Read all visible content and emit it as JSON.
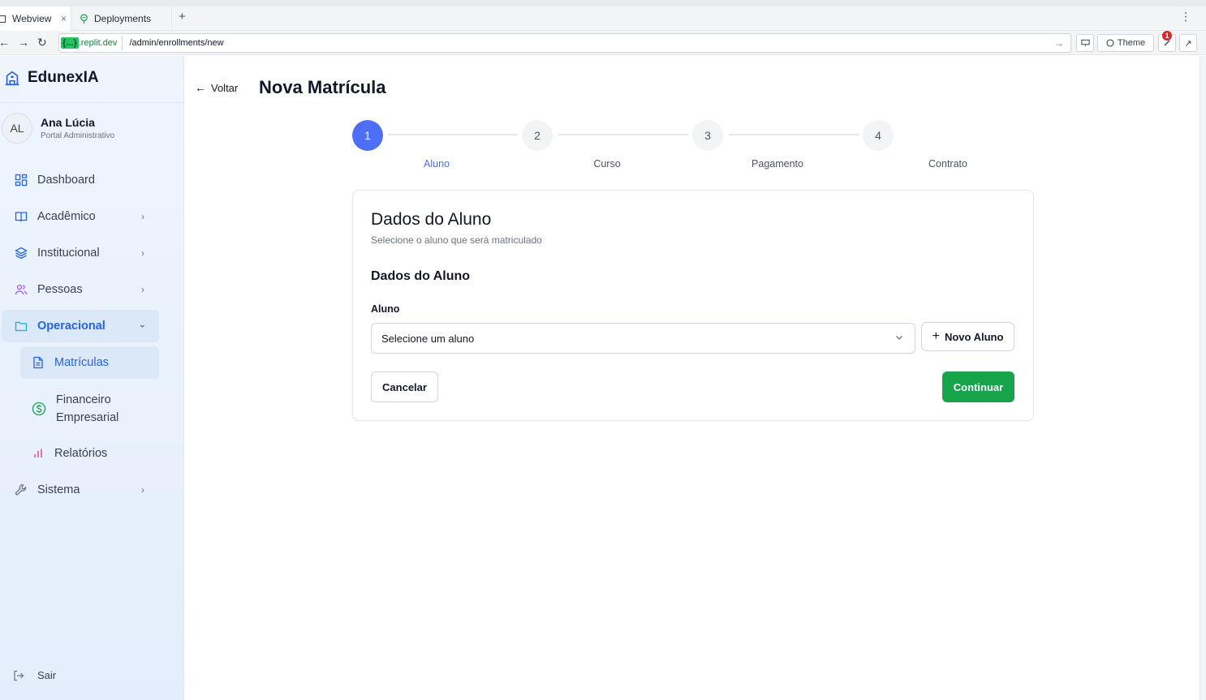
{
  "browser": {
    "tabs": [
      {
        "label": "Webview",
        "close": "×"
      },
      {
        "label": "Deployments"
      }
    ],
    "new_tab": "+",
    "url_host_badge": "{...}",
    "url_host": ".replit.dev",
    "url_path": "/admin/enrollments/new",
    "theme_label": "Theme",
    "notification_count": "1"
  },
  "sidebar": {
    "brand": "EdunexIA",
    "user": {
      "initials": "AL",
      "name": "Ana Lúcia",
      "role": "Portal Administrativo"
    },
    "items": [
      {
        "label": "Dashboard",
        "icon": "dashboard-icon"
      },
      {
        "label": "Acadêmico",
        "icon": "book-icon"
      },
      {
        "label": "Institucional",
        "icon": "layers-icon"
      },
      {
        "label": "Pessoas",
        "icon": "users-icon"
      },
      {
        "label": "Operacional",
        "icon": "folder-icon"
      },
      {
        "label": "Sistema",
        "icon": "wrench-icon"
      }
    ],
    "subitems": [
      {
        "label": "Matrículas",
        "icon": "file-icon"
      },
      {
        "label": "Financeiro",
        "label2": "Empresarial",
        "icon": "dollar-icon"
      },
      {
        "label": "Relatórios",
        "icon": "bar-chart-icon"
      }
    ],
    "logout": "Sair"
  },
  "main": {
    "back": "Voltar",
    "title": "Nova Matrícula",
    "steps": [
      {
        "number": "1",
        "label": "Aluno"
      },
      {
        "number": "2",
        "label": "Curso"
      },
      {
        "number": "3",
        "label": "Pagamento"
      },
      {
        "number": "4",
        "label": "Contrato"
      }
    ],
    "card": {
      "title": "Dados do Aluno",
      "subtitle": "Selecione o aluno que será matriculado",
      "section": "Dados do Aluno",
      "field_label": "Aluno",
      "select_placeholder": "Selecione um aluno",
      "new_student": "Novo Aluno",
      "cancel": "Cancelar",
      "continue": "Continuar"
    }
  },
  "colors": {
    "accent": "#4f6ef7",
    "primary_blue": "#2563eb",
    "success": "#16a34a"
  }
}
